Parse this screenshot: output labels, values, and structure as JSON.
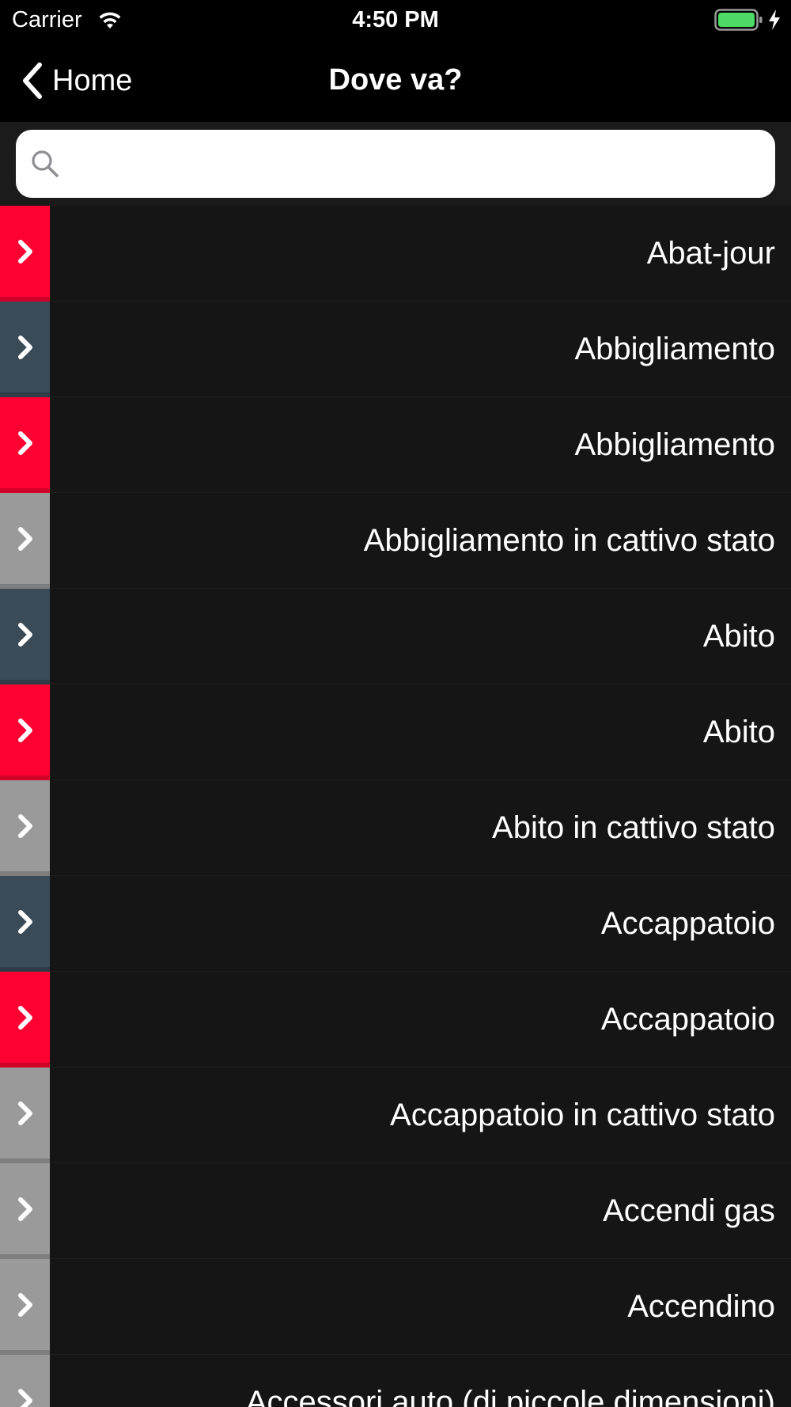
{
  "status_bar": {
    "carrier": "Carrier",
    "time": "4:50 PM",
    "icons": [
      "wifi-icon",
      "battery-icon",
      "charging-icon"
    ],
    "battery_color": "#4cd964"
  },
  "nav_bar": {
    "back_label": "Home",
    "back_icon": "chevron-left-icon",
    "title": "Dove va?"
  },
  "search": {
    "icon": "search-icon",
    "value": "",
    "placeholder": ""
  },
  "colors": {
    "background": "#000000",
    "list_background": "#151515",
    "red": "#ff0033",
    "slate": "#3b4a57",
    "gray": "#9a9a9a"
  },
  "list": {
    "item_icon": "chevron-right-icon",
    "items": [
      {
        "label": "Abat-jour",
        "color": "#ff0033"
      },
      {
        "label": "Abbigliamento",
        "color": "#3b4a57"
      },
      {
        "label": "Abbigliamento",
        "color": "#ff0033"
      },
      {
        "label": "Abbigliamento in cattivo stato",
        "color": "#9a9a9a"
      },
      {
        "label": "Abito",
        "color": "#3b4a57"
      },
      {
        "label": "Abito",
        "color": "#ff0033"
      },
      {
        "label": "Abito in cattivo stato",
        "color": "#9a9a9a"
      },
      {
        "label": "Accappatoio",
        "color": "#3b4a57"
      },
      {
        "label": "Accappatoio",
        "color": "#ff0033"
      },
      {
        "label": "Accappatoio in cattivo stato",
        "color": "#9a9a9a"
      },
      {
        "label": "Accendi gas",
        "color": "#9a9a9a"
      },
      {
        "label": "Accendino",
        "color": "#9a9a9a"
      },
      {
        "label": "Accessori auto (di piccole dimensioni)",
        "color": "#9a9a9a"
      }
    ]
  }
}
